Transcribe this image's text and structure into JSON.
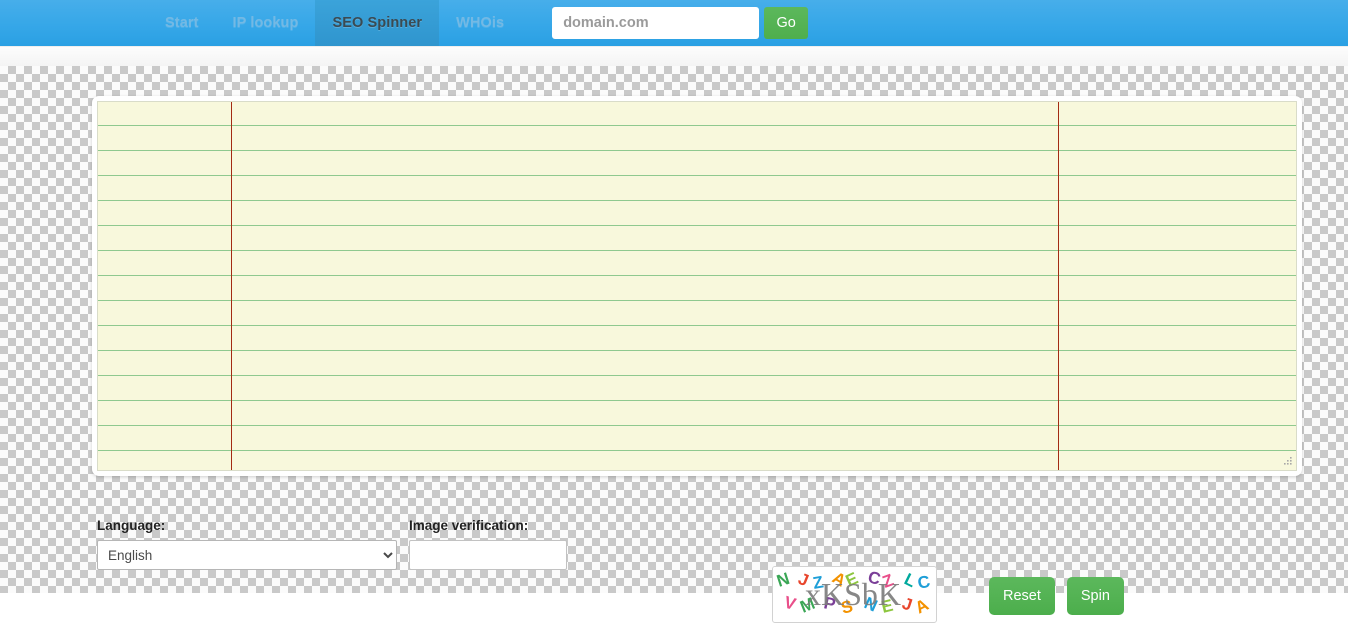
{
  "nav": {
    "tabs": [
      {
        "label": "Start",
        "active": false
      },
      {
        "label": "IP lookup",
        "active": false
      },
      {
        "label": "SEO Spinner",
        "active": true
      },
      {
        "label": "WHOis",
        "active": false
      }
    ],
    "search": {
      "value": "",
      "placeholder": "domain.com"
    },
    "go_label": "Go",
    "accent_color": "#36a7e8",
    "active_tab_color": "#3398d3",
    "go_button_color": "#5cb85c"
  },
  "editor": {
    "value": "",
    "placeholder": "",
    "paper_color": "#f8f8dc",
    "rule_color": "#8fc98f",
    "margin_color": "#a32b14",
    "line_height_px": 25,
    "visible_line_count": 15
  },
  "controls": {
    "language": {
      "label": "Language:",
      "selected": "English",
      "options": [
        "English"
      ]
    },
    "image_verification": {
      "label": "Image verification:",
      "value": "",
      "placeholder": ""
    },
    "captcha": {
      "text": "xKSbK",
      "alt": "captcha-image",
      "decoy_letters": [
        "Z",
        "S",
        "J",
        "N",
        "E",
        "C",
        "A",
        "P",
        "L",
        "Z",
        "N",
        "V",
        "C",
        "J",
        "M",
        "E"
      ],
      "decoy_colors": [
        "#7b3f98",
        "#e8452c",
        "#f39200",
        "#3aa655",
        "#1f9fd8",
        "#e94f8a",
        "#8dc63f",
        "#00a99d"
      ]
    },
    "buttons": {
      "reset_label": "Reset",
      "spin_label": "Spin",
      "color": "#5cb85c"
    }
  }
}
